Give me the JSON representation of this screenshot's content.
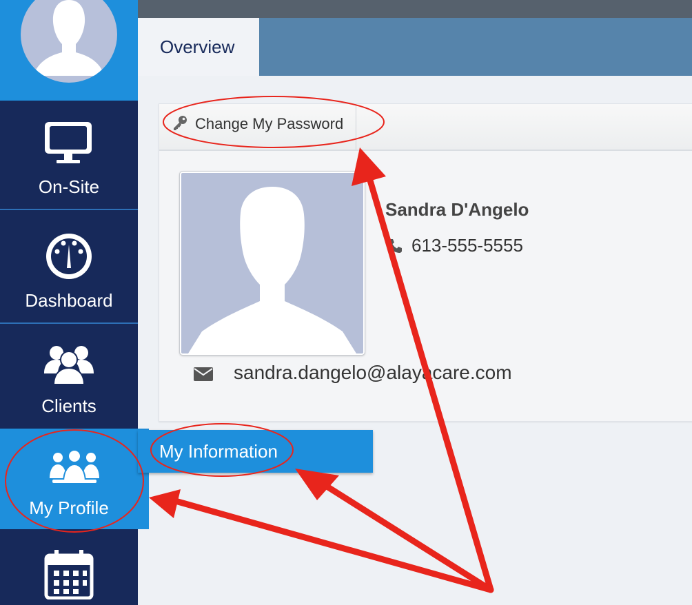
{
  "sidebar": {
    "items": [
      {
        "label": "On-Site",
        "icon": "monitor-icon"
      },
      {
        "label": "Dashboard",
        "icon": "gauge-icon"
      },
      {
        "label": "Clients",
        "icon": "users-icon"
      },
      {
        "label": "My Profile",
        "icon": "team-icon",
        "active": true
      },
      {
        "label": "",
        "icon": "calendar-icon"
      }
    ]
  },
  "tabs": {
    "overview": "Overview"
  },
  "toolbar": {
    "change_password": "Change My Password"
  },
  "profile": {
    "name": "Sandra D'Angelo",
    "phone": "613-555-5555",
    "email": "sandra.dangelo@alayacare.com"
  },
  "submenu": {
    "my_information": "My Information"
  },
  "colors": {
    "sidebar": "#17295a",
    "accent": "#1e8fdc",
    "tabstrip": "#5684ab",
    "annotation": "#e8251c"
  }
}
